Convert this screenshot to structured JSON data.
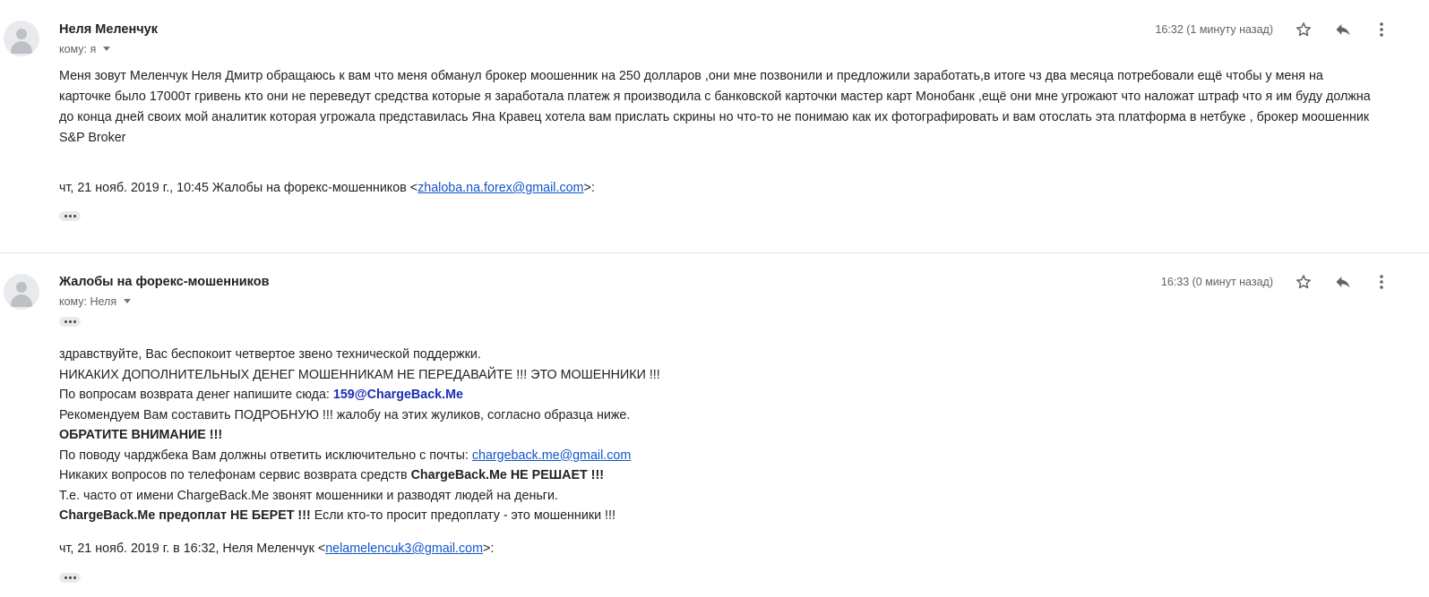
{
  "message1": {
    "sender": "Неля Меленчук",
    "to_label": "кому: я",
    "time": "16:32 (1 минуту назад)",
    "body": "Меня зовут Меленчук Неля Дмитр обращаюсь к вам что меня обманул брокер моошенник на 250 долларов ,они мне позвонили и предложили заработать,в итоге чз два месяца потребовали ещё чтобы у меня на карточке было 17000т гривень кто они не переведут средства которые я заработала платеж я производила с банковской карточки мастер карт Монобанк ,ещё они мне угрожают что наложат штраф что я им буду должна до конца дней своих мой аналитик которая угрожала представилась Яна Кравец хотела вам прислать скрины но что-то не понимаю как их фотографировать и вам отослать эта платформа в нетбуке , брокер моошенник S&P Broker",
    "quote_prefix": "чт, 21 нояб. 2019 г., 10:45 Жалобы на форекс-мошенников <",
    "quote_email": "zhaloba.na.forex@gmail.com",
    "quote_suffix": ">:"
  },
  "message2": {
    "sender": "Жалобы на форекс-мошенников",
    "to_label": "кому: Неля",
    "time": "16:33 (0 минут назад)",
    "lines": {
      "l1": "здравствуйте, Вас беспокоит четвертое звено технической поддержки.",
      "l2": "НИКАКИХ ДОПОЛНИТЕЛЬНЫХ ДЕНЕГ МОШЕННИКАМ НЕ ПЕРЕДАВАЙТЕ !!! ЭТО МОШЕННИКИ !!!",
      "l3_prefix": "По вопросам возврата денег напишите сюда: ",
      "l3_email": "159@ChargeBack.Me",
      "l4": "Рекомендуем Вам составить ПОДРОБНУЮ !!! жалобу на этих жуликов, согласно образца ниже.",
      "l5": "ОБРАТИТЕ ВНИМАНИЕ !!!",
      "l6_prefix": "По поводу чарджбека Вам должны ответить исключительно с почты: ",
      "l6_email": "chargeback.me@gmail.com",
      "l7_prefix": "Никаких вопросов по телефонам сервис возврата средств ",
      "l7_bold": "ChargeBack.Me НЕ РЕШАЕТ !!!",
      "l8": "Т.е. часто от имени ChargeBack.Me звонят мошенники и разводят людей на деньги.",
      "l9_bold": "ChargeBack.Me предоплат НЕ БЕРЕТ !!!",
      "l9_suffix": " Если кто-то просит предоплату - это мошенники !!!"
    },
    "quote_prefix": "чт, 21 нояб. 2019 г. в 16:32, Неля Меленчук <",
    "quote_email": "nelamelencuk3@gmail.com",
    "quote_suffix": ">:"
  },
  "icons": [
    "avatar-icon",
    "star-icon",
    "reply-icon",
    "more-vert-icon",
    "chevron-down-icon",
    "ellipsis-icon"
  ],
  "colors": {
    "link": "#1155cc",
    "bold_link": "#1c2fb5",
    "meta": "#5f6368"
  }
}
